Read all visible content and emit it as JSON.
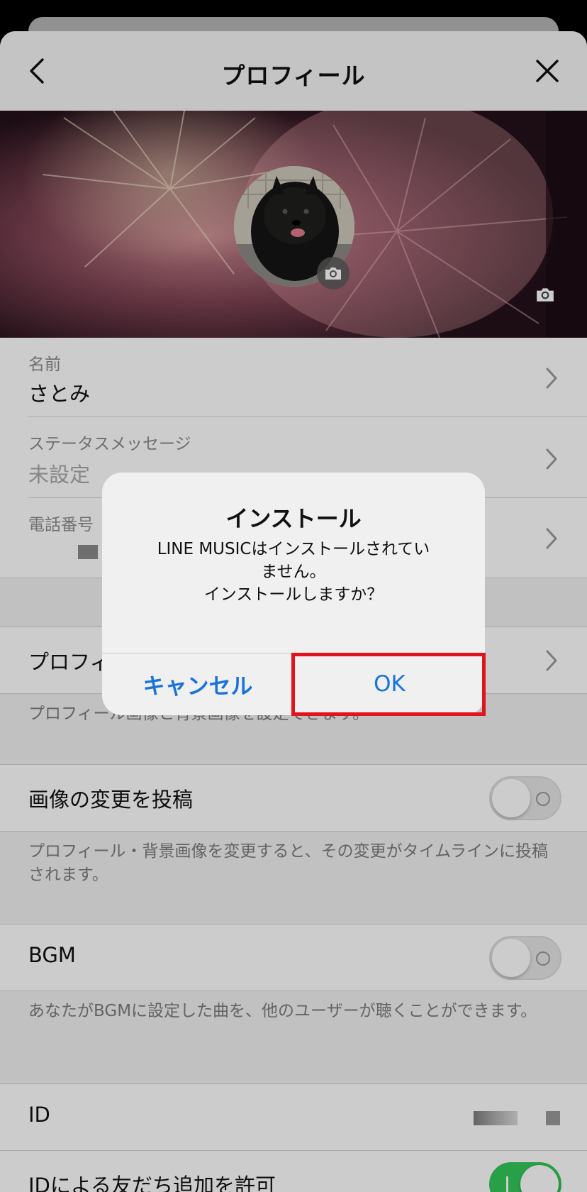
{
  "nav": {
    "title": "プロフィール"
  },
  "profile": {
    "name_label": "名前",
    "name_value": "さとみ",
    "status_label": "ステータスメッセージ",
    "status_value": "未設定",
    "phone_label": "電話番号"
  },
  "settings": {
    "profile_image_row_partial": "プロフィ",
    "profile_image_desc": "プロフィール画像と背景画像を設定できます。",
    "post_change_label": "画像の変更を投稿",
    "post_change_on": false,
    "post_change_desc": "プロフィール・背景画像を変更すると、その変更がタイムラインに投稿されます。",
    "bgm_label": "BGM",
    "bgm_on": false,
    "bgm_desc": "あなたがBGMに設定した曲を、他のユーザーが聴くことができます。",
    "id_label": "ID",
    "id_add_label": "IDによる友だち追加を許可",
    "id_add_on": true
  },
  "alert": {
    "title": "インストール",
    "message_line1": "LINE MUSICはインストールされてい",
    "message_line2": "ません。",
    "message_line3": "インストールしますか？",
    "cancel_label": "キャンセル",
    "ok_label": "OK"
  },
  "colors": {
    "accent": "#1a73d9",
    "highlight": "#e0141c",
    "toggle_on": "#34c759"
  }
}
